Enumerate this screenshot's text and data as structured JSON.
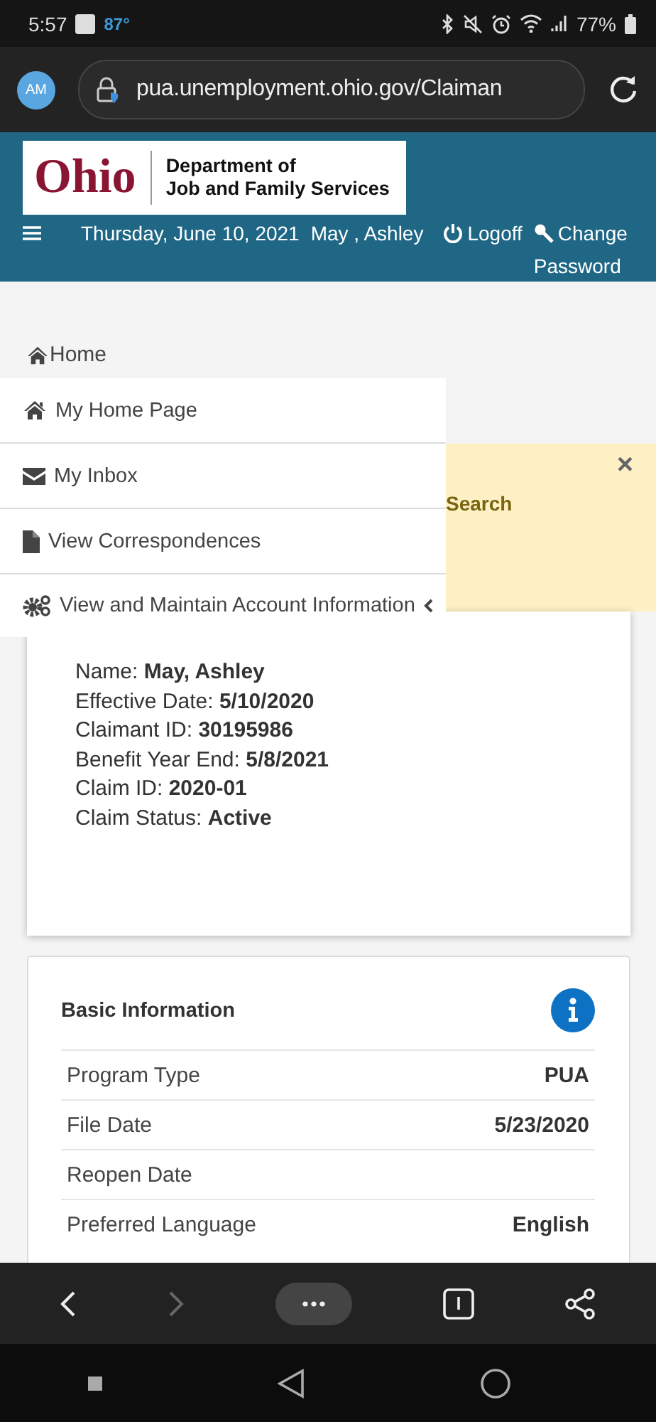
{
  "status_bar": {
    "time": "5:57",
    "temperature": "87°",
    "battery": "77%"
  },
  "browser": {
    "avatar": "AM",
    "url": "pua.unemployment.ohio.gov/Claiman"
  },
  "header": {
    "logo_word": "Ohio",
    "logo_subtitle_1": "Department of",
    "logo_subtitle_2": "Job and Family Services",
    "date": "Thursday, June 10, 2021",
    "user": "May , Ashley",
    "logoff": "Logoff",
    "change_password_1": "Change",
    "change_password_2": "Password"
  },
  "breadcrumb": "Home",
  "menu": {
    "items": [
      {
        "label": "My Home Page",
        "kind": "home"
      },
      {
        "label": "My Inbox",
        "kind": "inbox"
      },
      {
        "label": "View Correspondences",
        "kind": "document"
      },
      {
        "label": "View and Maintain Account Information",
        "kind": "settings",
        "expanded": false
      }
    ]
  },
  "alert": {
    "text": "Search",
    "close": "×"
  },
  "summary": {
    "lines": [
      "Name: **May, Ashley**",
      "Effective Date: **5/10/2020**",
      "Claimant ID: **30195986**",
      "Benefit Year End: **5/8/2021**",
      "Claim ID: **2020-01**",
      "Claim Status: **Active**"
    ]
  },
  "basic_info": {
    "title": "Basic Information",
    "rows": [
      {
        "label": "Program Type",
        "value": "PUA"
      },
      {
        "label": "File Date",
        "value": "5/23/2020"
      },
      {
        "label": "Reopen Date"
      },
      {
        "label": "Preferred Language",
        "value": "English"
      }
    ]
  },
  "bottom_nav": {
    "back_disabled": false,
    "forward_disabled": true
  }
}
